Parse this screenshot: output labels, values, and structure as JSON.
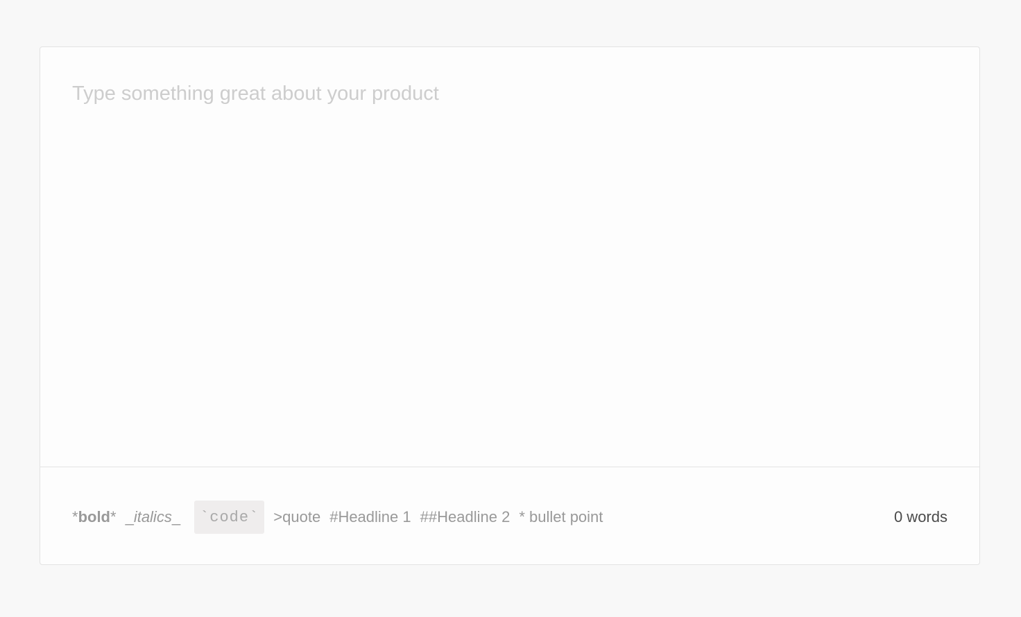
{
  "editor": {
    "placeholder": "Type something great about your product",
    "value": ""
  },
  "hints": {
    "bold": {
      "open": "*",
      "label": "bold",
      "close": "*"
    },
    "italic": {
      "open": "_",
      "label": "italics",
      "close": "_"
    },
    "code": "`code`",
    "quote": ">quote",
    "headline1": "#Headline 1",
    "headline2": "##Headline 2",
    "bullet": "* bullet point"
  },
  "word_count": "0 words"
}
